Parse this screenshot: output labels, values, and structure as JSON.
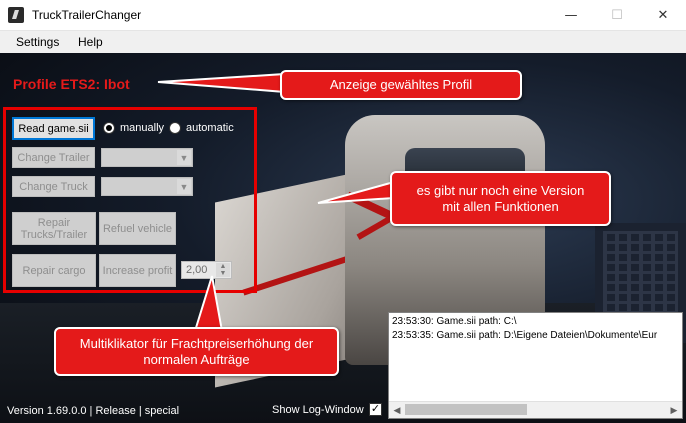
{
  "window": {
    "title": "TruckTrailerChanger",
    "min": "—",
    "max": "☐",
    "close": "✕"
  },
  "menu": {
    "items": [
      "Settings",
      "Help"
    ]
  },
  "profile_label": "Profile ETS2: Ibot",
  "controls": {
    "read_button": "Read game.sii",
    "radio_manual": "manually",
    "radio_auto": "automatic",
    "radio_selected": "manually",
    "change_trailer": "Change Trailer",
    "change_truck": "Change Truck",
    "repair_trucks": "Repair Trucks/Trailer",
    "refuel": "Refuel vehicle",
    "repair_cargo": "Repair cargo",
    "increase_profit": "Increase profit",
    "profit_multiplier": "2,00"
  },
  "callouts": {
    "profile": "Anzeige gewähltes Profil",
    "version": "es gibt nur noch eine Version mit allen Funktionen",
    "multiplier": "Multiklikator für Frachtpreiserhöhung der normalen Aufträge"
  },
  "log": {
    "lines": [
      "23:53:30: Game.sii path: C:\\",
      "23:53:35: Game.sii path: D:\\Eigene Dateien\\Dokumente\\Eur"
    ]
  },
  "footer": {
    "version": "Version 1.69.0.0 | Release | special",
    "show_log": "Show Log-Window",
    "show_log_checked": "✓"
  },
  "colors": {
    "accent_red": "#e41a1a",
    "focus_blue": "#0078d7"
  }
}
